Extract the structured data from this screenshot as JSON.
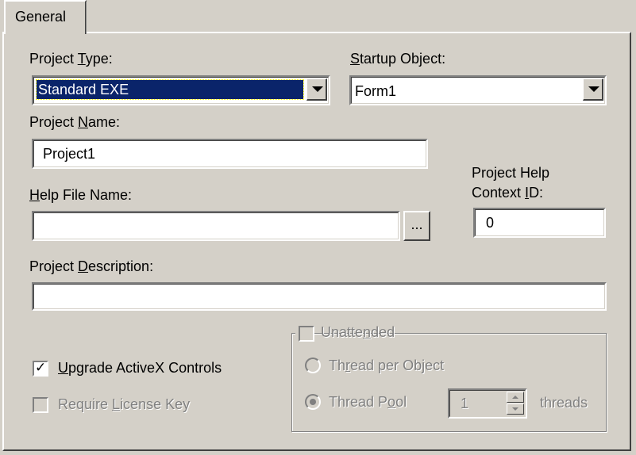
{
  "tab": {
    "label": "General"
  },
  "project_type": {
    "label_pre": "Project ",
    "label_key": "T",
    "label_post": "ype:",
    "value": "Standard EXE"
  },
  "startup_object": {
    "label_key": "S",
    "label_post": "tartup Object:",
    "value": "Form1"
  },
  "project_name": {
    "label_pre": "Project ",
    "label_key": "N",
    "label_post": "ame:",
    "value": "Project1"
  },
  "help_file": {
    "label_key": "H",
    "label_post": "elp File Name:",
    "value": "",
    "browse_label": "..."
  },
  "help_context": {
    "line1": "Project Help",
    "line2_pre": "Context ",
    "line2_key": "I",
    "line2_post": "D:",
    "value": "0"
  },
  "project_description": {
    "label_pre": "Project ",
    "label_key": "D",
    "label_post": "escription:",
    "value": ""
  },
  "upgrade_activex": {
    "label_key": "U",
    "label_post": "pgrade ActiveX Controls",
    "checked": true
  },
  "require_license": {
    "label_pre": "Require ",
    "label_key": "L",
    "label_post": "icense Key",
    "checked": false,
    "enabled": false
  },
  "unattended": {
    "label_pre": "Unatte",
    "label_key": "n",
    "label_post": "ded",
    "checked": false,
    "enabled": false,
    "thread_per_object": {
      "label_pre": "Th",
      "label_key": "r",
      "label_post": "ead per Object"
    },
    "thread_pool": {
      "label_pre": "Thread P",
      "label_key": "o",
      "label_post": "ol",
      "value": "1",
      "suffix": "threads",
      "selected": true
    }
  },
  "colors": {
    "face": "#d4d0c8",
    "highlight": "#0a246a",
    "disabled": "#808080"
  },
  "icons": {
    "check": "check-mark-icon",
    "dropdown": "chevron-down-icon",
    "spin_up": "arrow-up-icon",
    "spin_down": "arrow-down-icon"
  }
}
